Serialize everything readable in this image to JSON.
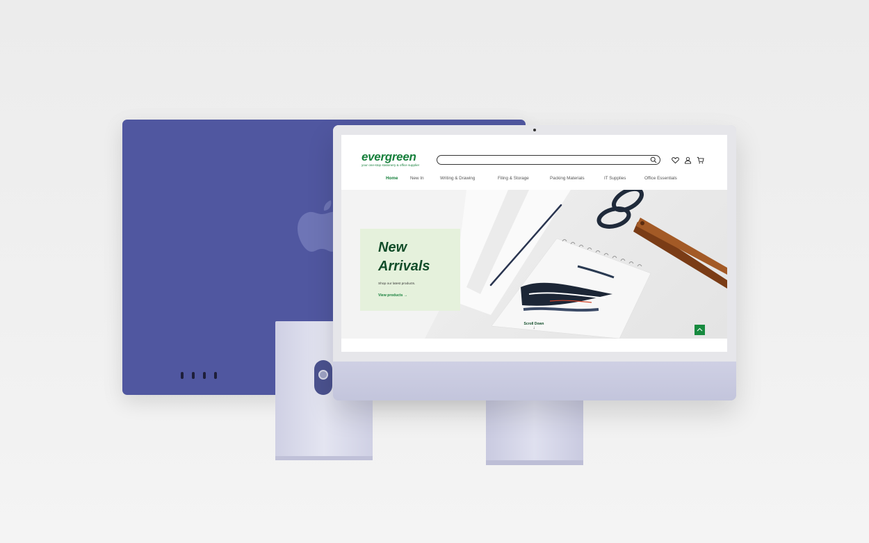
{
  "site": {
    "logo": "evergreen",
    "tagline": "your one-stop stationery & office supplier",
    "search": {
      "value": "",
      "placeholder": ""
    },
    "nav": [
      "Home",
      "New In",
      "Writing & Drawing",
      "Filing & Storage",
      "Packing Materials",
      "IT Supplies",
      "Office Essentials"
    ],
    "active_nav": "Home"
  },
  "hero": {
    "title_line1": "New",
    "title_line2": "Arrivals",
    "subtitle": "Shop our latest products.",
    "link_label": "View products",
    "link_arrow": "→",
    "scroll_label": "Scroll Down",
    "scroll_arrow": "↓"
  },
  "icons": {
    "search": "search-icon",
    "wishlist": "heart-icon",
    "account": "user-icon",
    "cart": "cart-icon",
    "back_to_top": "chevron-up-icon"
  },
  "colors": {
    "brand_green": "#17803c",
    "dark_green": "#124d2a",
    "hero_card_bg": "#e5f1dc",
    "device_purple": "#5057a0",
    "device_lilac": "#c5c7dc"
  }
}
